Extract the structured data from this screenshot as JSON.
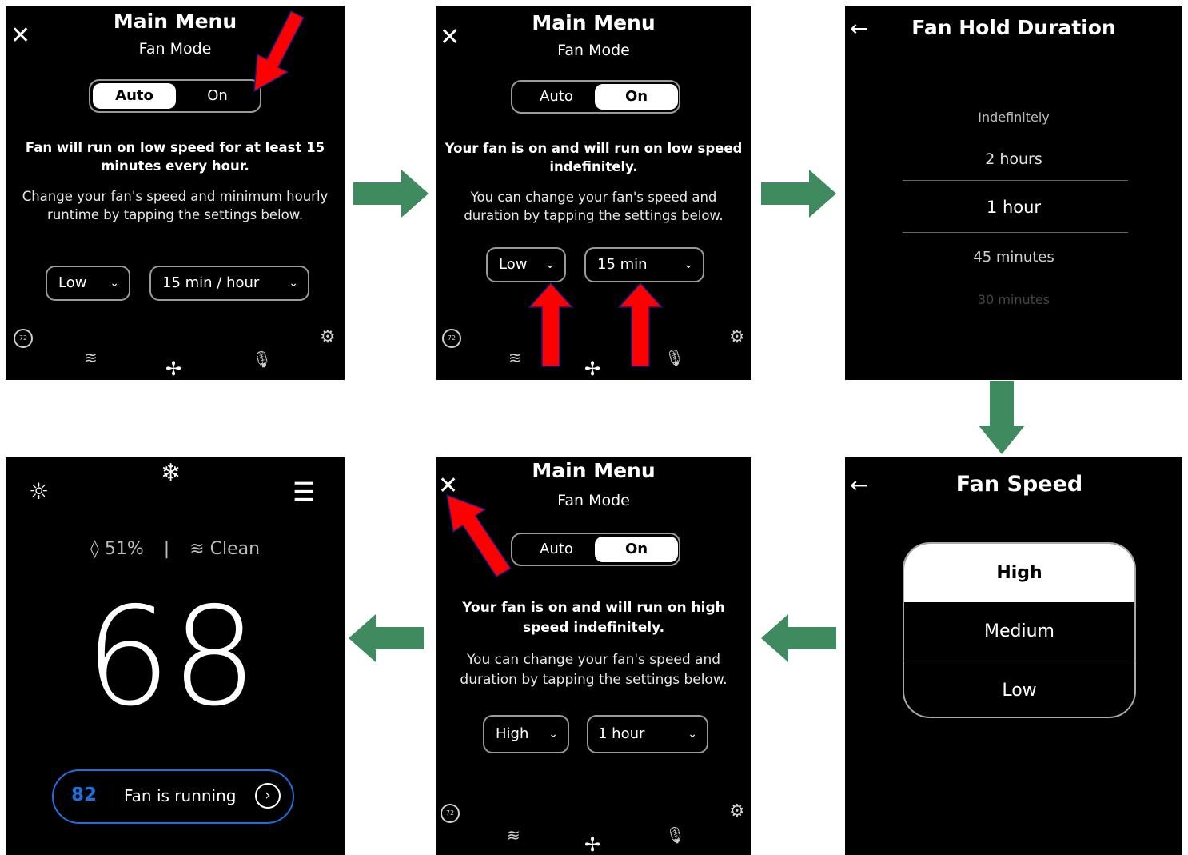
{
  "screen1": {
    "title": "Main Menu",
    "subtitle": "Fan Mode",
    "toggle": {
      "auto": "Auto",
      "on": "On",
      "selected": "auto"
    },
    "message_bold": "Fan will run on low speed for at least 15 minutes every hour.",
    "message": "Change your fan's speed and minimum hourly runtime by tapping the settings below.",
    "speed_dropdown": "Low",
    "duration_dropdown": "15 min / hour",
    "badge": "72"
  },
  "screen2": {
    "title": "Main Menu",
    "subtitle": "Fan Mode",
    "toggle": {
      "auto": "Auto",
      "on": "On",
      "selected": "on"
    },
    "message_bold": "Your fan is on and will run on low speed indefinitely.",
    "message": "You can change your fan's speed and duration by tapping the settings below.",
    "speed_dropdown": "Low",
    "duration_dropdown": "15 min",
    "badge": "72"
  },
  "screen3": {
    "title": "Fan Hold Duration",
    "options": [
      "Indefinitely",
      "2 hours",
      "1 hour",
      "45 minutes",
      "30 minutes"
    ],
    "selected": "1 hour"
  },
  "screen4": {
    "title": "Fan Speed",
    "options": [
      "High",
      "Medium",
      "Low"
    ],
    "selected": "High"
  },
  "screen5": {
    "title": "Main Menu",
    "subtitle": "Fan Mode",
    "toggle": {
      "auto": "Auto",
      "on": "On",
      "selected": "on"
    },
    "message_bold": "Your fan is on and will run on high speed indefinitely.",
    "message": "You can change your fan's speed and duration by tapping the settings below.",
    "speed_dropdown": "High",
    "duration_dropdown": "1 hour",
    "badge": "72"
  },
  "screen6": {
    "humidity": "51%",
    "separator": "|",
    "air_quality": "Clean",
    "temperature": "68",
    "status_setpoint": "82",
    "status_text": "Fan is running"
  },
  "colors": {
    "screen_bg": "#000000",
    "flow_arrow": "#3f8a5f",
    "highlight_arrow": "#ff0000",
    "setpoint_blue": "#1e6fe0"
  }
}
